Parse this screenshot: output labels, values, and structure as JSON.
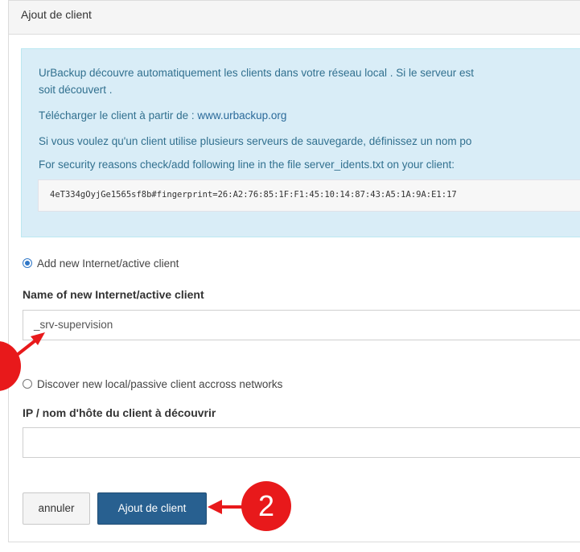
{
  "panel": {
    "title": "Ajout de client"
  },
  "info": {
    "line1": "UrBackup découvre automatiquement les clients dans votre réseau local . Si le serveur est",
    "line2": "soit découvert .",
    "download_text": "Télécharger le client à partir de : ",
    "download_link": "www.urbackup.org",
    "line4": "Si vous voulez qu'un client utilise plusieurs serveurs de sauvegarde, définissez un nom po",
    "line5": "For security reasons check/add following line in the file server_idents.txt on your client:",
    "code": "4eT334gOyjGe1565sf8b#fingerprint=26:A2:76:85:1F:F1:45:10:14:87:43:A5:1A:9A:E1:17"
  },
  "form": {
    "radio_internet": {
      "label": "Add new Internet/active client",
      "checked": true
    },
    "internet_name_label": "Name of new Internet/active client",
    "internet_name_value": "_srv-supervision",
    "radio_discover": {
      "label": "Discover new local/passive client accross networks",
      "checked": false
    },
    "host_label": "IP / nom d'hôte du client à découvrir",
    "host_value": ""
  },
  "buttons": {
    "cancel": "annuler",
    "add": "Ajout de client"
  },
  "annotations": {
    "marker2": "2",
    "color": "#e8191b"
  }
}
